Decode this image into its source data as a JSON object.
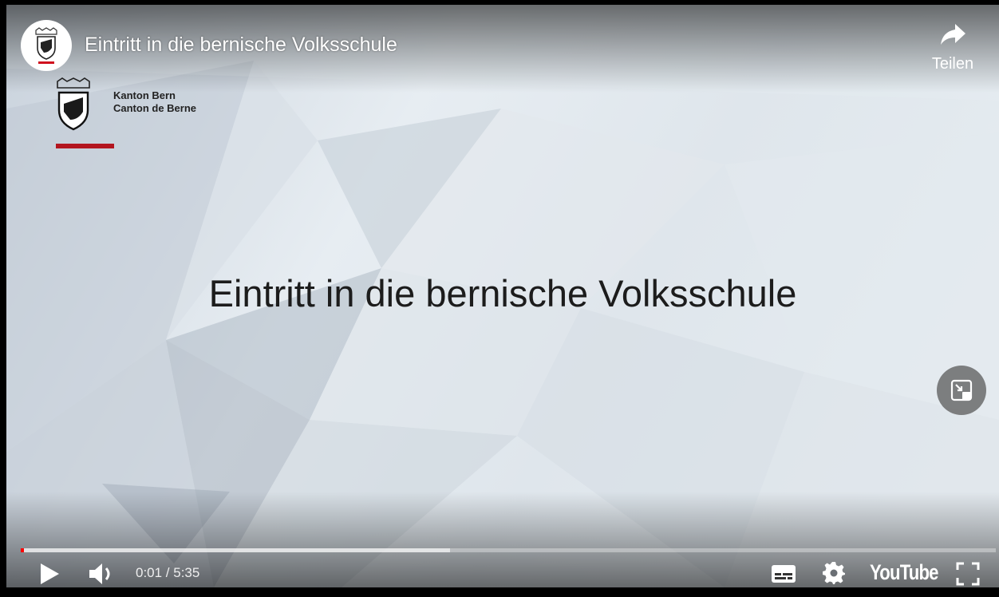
{
  "video": {
    "title": "Eintritt in die bernische Volksschule",
    "slide_title": "Eintritt in die bernische Volksschule",
    "logo_line1": "Kanton Bern",
    "logo_line2": "Canton de Berne"
  },
  "share": {
    "icon": "share-arrow-icon",
    "label": "Teilen"
  },
  "player": {
    "current_time": "0:01",
    "duration": "5:35",
    "time_display": "0:01 / 5:35",
    "played_fraction": 0.003,
    "buffered_fraction": 0.44,
    "brand": "YouTube"
  },
  "icons": {
    "play": "play-icon",
    "volume": "volume-icon",
    "subtitles": "subtitles-icon",
    "settings": "gear-icon",
    "fullscreen": "fullscreen-icon",
    "miniplayer": "miniplayer-icon"
  },
  "colors": {
    "accent_red": "#ff0000",
    "bern_red": "#b3151f"
  }
}
